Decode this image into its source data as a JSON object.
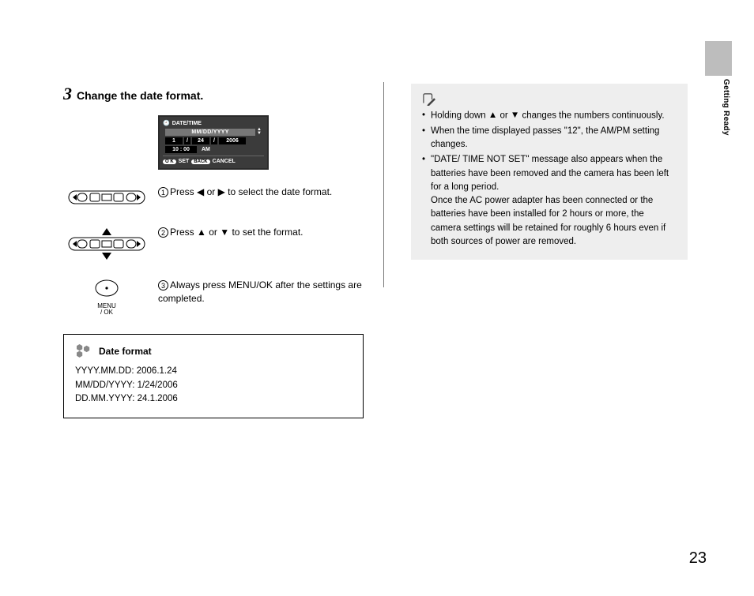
{
  "side": {
    "tab_text": "Getting Ready"
  },
  "step": {
    "number": "3",
    "title": "Change the date format."
  },
  "lcd": {
    "header": "DATE/TIME",
    "format_field": "MM/DD/YYYY",
    "date_month": "1",
    "date_sep": "/",
    "date_day": "24",
    "date_year": "2006",
    "time": "10 : 00",
    "ampm": "AM",
    "ok_badge": "O K",
    "set": "SET",
    "back_badge": "BACK",
    "cancel": "CANCEL"
  },
  "instructions": {
    "i1": {
      "num": "1",
      "pre": "Press ",
      "mid": " or ",
      "post": " to select the date format."
    },
    "i2": {
      "num": "2",
      "pre": "Press ",
      "mid": " or ",
      "post": " to set the format."
    },
    "i3": {
      "num": "3",
      "txt": "Always press MENU/OK after the settings are completed."
    },
    "menuok_label_l1": "MENU",
    "menuok_label_l2": "/ OK"
  },
  "datebox": {
    "heading": "Date format",
    "l1": "YYYY.MM.DD: 2006.1.24",
    "l2": "MM/DD/YYYY: 1/24/2006",
    "l3": "DD.MM.YYYY: 24.1.2006"
  },
  "notes": {
    "li1a": "Holding down ",
    "li1b": " or ",
    "li1c": " changes the numbers continuously.",
    "li2": "When the time displayed passes \"12\", the AM/PM setting changes.",
    "li3": "\"DATE/ TIME NOT SET\" message also appears when the batteries have been removed and the camera has been left for a long period.",
    "li3b": "Once the AC power adapter has been connected or the batteries have been installed for 2 hours or more, the camera settings will be retained for roughly 6 hours even if both sources of power are removed."
  },
  "page_number": "23"
}
